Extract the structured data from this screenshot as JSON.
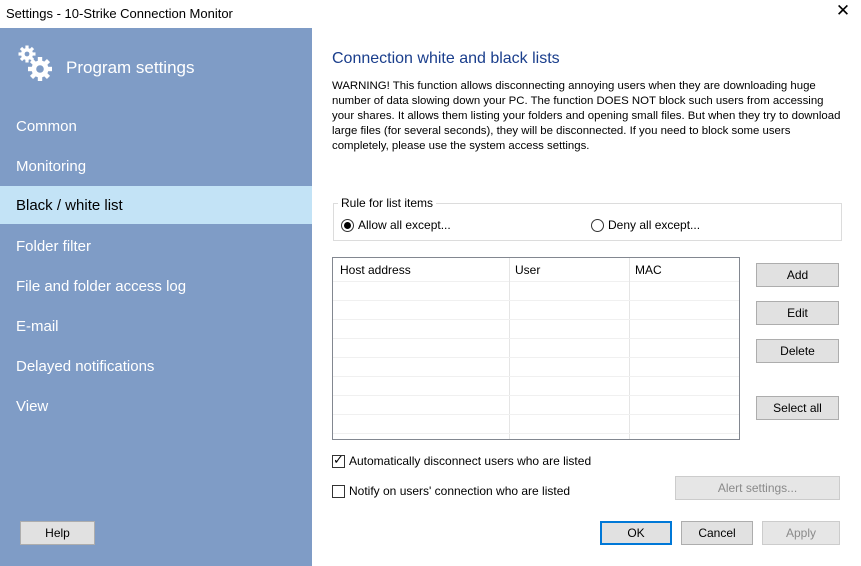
{
  "window": {
    "title": "Settings - 10-Strike Connection Monitor",
    "close_icon": "close-icon"
  },
  "sidebar": {
    "header": "Program settings",
    "items": [
      {
        "label": "Common",
        "active": false
      },
      {
        "label": "Monitoring",
        "active": false
      },
      {
        "label": "Black / white list",
        "active": true
      },
      {
        "label": "Folder filter",
        "active": false
      },
      {
        "label": "File and folder access log",
        "active": false
      },
      {
        "label": "E-mail",
        "active": false
      },
      {
        "label": "Delayed notifications",
        "active": false
      },
      {
        "label": "View",
        "active": false
      }
    ],
    "help_label": "Help"
  },
  "content": {
    "title": "Connection white and black lists",
    "warning": "WARNING! This function allows disconnecting annoying users when they are downloading huge number of data slowing down your PC. The function DOES NOT block such users from accessing your shares. It allows them listing your folders and opening small files. But when they try to download large files (for several seconds), they will be disconnected. If you need to block some users completely, please use the system access settings.",
    "rule": {
      "legend": "Rule for list items",
      "allow_label": "Allow all except...",
      "deny_label": "Deny all except...",
      "selected": "allow"
    },
    "table": {
      "columns": [
        "Host address",
        "User",
        "MAC"
      ],
      "rows": []
    },
    "buttons": {
      "add": "Add",
      "edit": "Edit",
      "delete": "Delete",
      "select_all": "Select all"
    },
    "auto_disconnect": {
      "label": "Automatically disconnect users who are listed",
      "checked": true
    },
    "notify": {
      "label": "Notify on users' connection who are listed",
      "checked": false
    },
    "alert_settings": "Alert settings..."
  },
  "footer": {
    "ok": "OK",
    "cancel": "Cancel",
    "apply": "Apply"
  },
  "colors": {
    "sidebar_bg": "#7f9cc6",
    "active_item_bg": "#c3e3f6",
    "title_color": "#1a3e8c"
  }
}
